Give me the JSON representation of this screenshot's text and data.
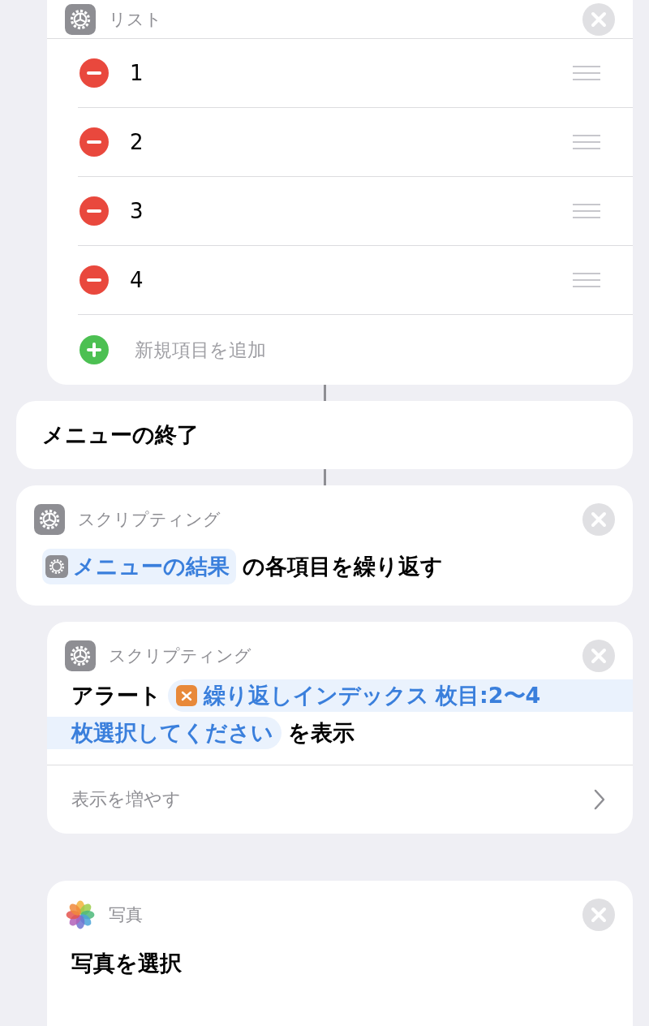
{
  "list_card": {
    "category": "リスト",
    "items": [
      {
        "text": "1"
      },
      {
        "text": "2"
      },
      {
        "text": "3"
      },
      {
        "text": "4"
      }
    ],
    "add_placeholder": "新規項目を追加"
  },
  "menu_end": {
    "title": "メニューの終了"
  },
  "repeat_card": {
    "category": "スクリプティング",
    "token": "メニューの結果",
    "text": "の各項目を繰り返す"
  },
  "alert_card": {
    "category": "スクリプティング",
    "prefix": "アラート",
    "variable": "繰り返しインデックス",
    "literal_lines": [
      "枚目:2〜4",
      "枚選択してください"
    ],
    "suffix": "を表示",
    "more": "表示を増やす"
  },
  "photo_card": {
    "category": "写真",
    "title": "写真を選択"
  }
}
